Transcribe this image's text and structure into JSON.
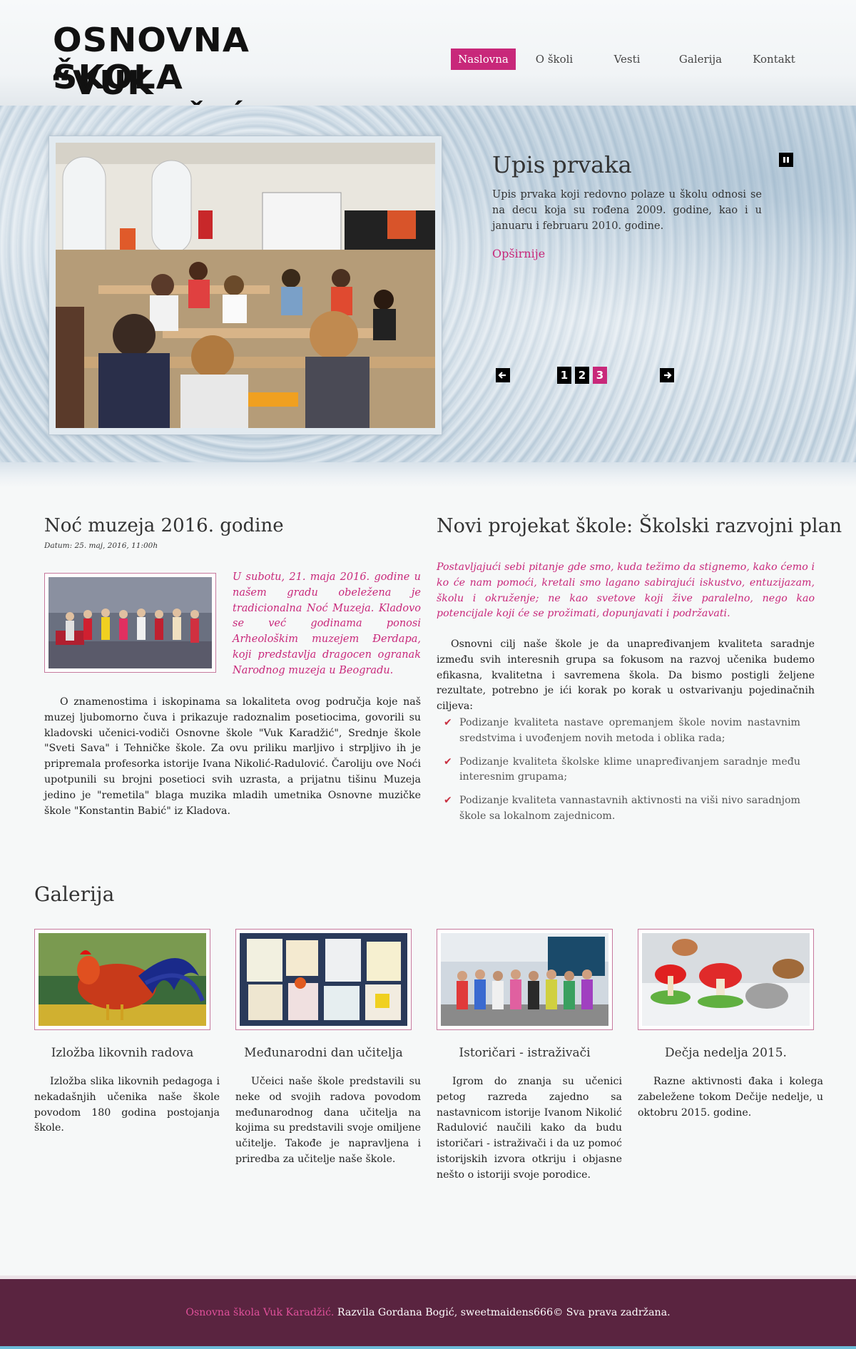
{
  "header": {
    "logo_line1": "OSNOVNA ŠKOLA",
    "logo_line2": "“VUK KARADŽIĆ”",
    "nav": [
      {
        "label": "Naslovna",
        "active": true
      },
      {
        "label": "O školi",
        "active": false
      },
      {
        "label": "Vesti",
        "active": false
      },
      {
        "label": "Galerija",
        "active": false
      },
      {
        "label": "Kontakt",
        "active": false
      }
    ]
  },
  "slider": {
    "title": "Upis prvaka",
    "text": "Upis prvaka koji redovno polaze u školu odnosi se na decu koja su rođena 2009. godine, kao i u januaru i februaru 2010. godine.",
    "more_label": "Opširnije",
    "pause_icon": "pause-icon",
    "prev_icon": "arrow-left-icon",
    "next_icon": "arrow-right-icon",
    "pages": [
      "1",
      "2",
      "3"
    ],
    "active_page": 3
  },
  "news": {
    "title": "Noć muzeja 2016. godine",
    "date": "Datum: 25. maj, 2016, 11:00h",
    "intro": "U subotu, 21. maja 2016. godine u našem gradu obeležena je tradicionalna Noć Muzeja. Kladovo se već godinama ponosi Arheološkim muzejem Đerdapa, koji predstavlja dragocen ogranak Narodnog muzeja u Beogradu.",
    "body": "O znamenostima i iskopinama sa lokaliteta ovog područja koje naš muzej ljubomorno čuva i prikazuje radoznalim posetiocima, govorili su kladovski učenici-vodiči Osnovne škole \"Vuk Karadžić\", Srednje škole \"Sveti Sava\" i Tehničke škole. Za ovu priliku marljivo i strpljivo ih je pripremala profesorka istorije Ivana Nikolić-Radulović. Čaroliju ove Noći upotpunili su brojni posetioci svih uzrasta, a prijatnu tišinu Muzeja jedino je \"remetila\" blaga muzika mladih umetnika Osnovne muzičke škole \"Konstantin Babić\" iz Kladova."
  },
  "project": {
    "title": "Novi projekat škole: Školski razvojni plan",
    "intro": "Postavljajući sebi pitanje gde smo, kuda težimo da stignemo, kako ćemo i ko će nam pomoći, kretali smo lagano sabirajući iskustvo, entuzijazam, školu i okruženje; ne kao svetove koji žive paralelno, nego kao potencijale koji će se prožimati, dopunjavati i podržavati.",
    "body": "Osnovni cilj naše škole je da unapređivanjem kvaliteta saradnje između svih interesnih grupa sa fokusom na razvoj učenika budemo efikasna, kvalitetna i savremena škola. Da bismo postigli željene rezultate, potrebno je ići korak po korak u ostvarivanju pojedinačnih ciljeva:",
    "items": [
      "Podizanje kvaliteta nastave opremanjem škole novim nastavnim sredstvima i uvođenjem novih metoda i oblika rada;",
      "Podizanje kvaliteta školske klime unapređivanjem saradnje među interesnim grupama;",
      "Podizanje kvaliteta vannastavnih aktivnosti na viši nivo saradnjom škole sa lokalnom zajednicom."
    ],
    "check_icon": "check-icon"
  },
  "gallery": {
    "title": "Galerija",
    "items": [
      {
        "title": "Izložba likovnih radova",
        "text": "Izložba slika likovnih pedagoga i nekadašnjih učenika naše škole povodom 180 godina postojanja škole."
      },
      {
        "title": "Međunarodni dan učitelja",
        "text": "Učeici naše škole predstavili su neke od svojih radova povodom međunarodnog dana učitelja na kojima su predstavili svoje omiljene učitelje. Takođe je napravljena i priredba za učitelje naše škole."
      },
      {
        "title": "Istoričari - istraživači",
        "text": "Igrom do znanja su učenici petog razreda zajedno sa nastavnicom istorije Ivanom Nikolić Radulović naučili kako da budu istoričari - istraživači i da uz pomoć istorijskih izvora otkriju i objasne nešto o istoriji svoje porodice."
      },
      {
        "title": "Dečja nedelja 2015.",
        "text": "Razne aktivnosti đaka i kolega zabeležene tokom Dečije nedelje, u oktobru 2015. godine."
      }
    ]
  },
  "footer": {
    "site_name": "Osnovna škola Vuk Karadžić.",
    "credits": " Razvila Gordana Bogić, sweetmaidens666© Sva prava zadržana."
  },
  "colors": {
    "accent": "#c8287a",
    "footer_bg": "#5a2440",
    "text": "#222222"
  }
}
